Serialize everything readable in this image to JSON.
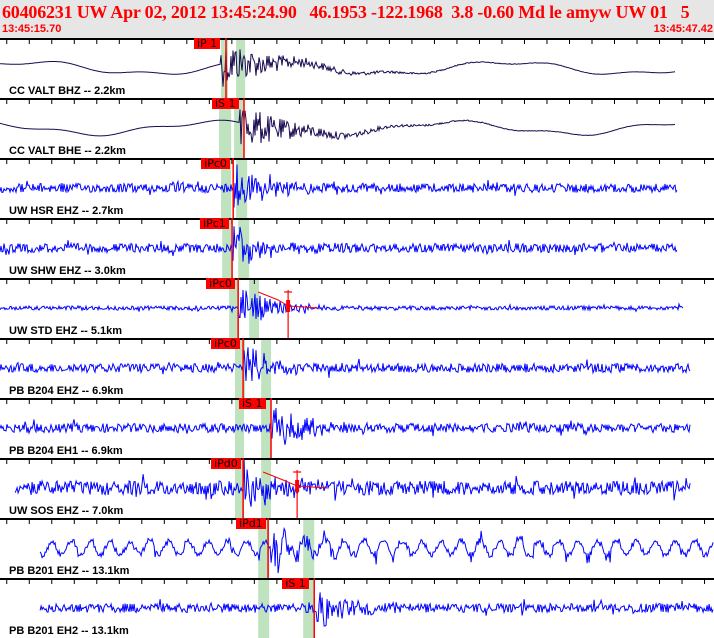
{
  "header": {
    "title": "60406231 UW Apr 02, 2012 13:45:24.90   46.1953 -122.1968  3.8 -0.60 Md le amyw UW 01   5",
    "start_time": "13:45:15.70",
    "end_time": "13:45:47.42"
  },
  "window_seconds": 31.72,
  "colors": {
    "pick": "#ff0000",
    "band": "#bfe3bf",
    "trace_bb": "#1a0a50",
    "trace_sp": "#0000ff",
    "header_text": "#ff0000"
  },
  "traces": [
    {
      "label": "CC VALT BHZ -- 2.2km",
      "pick": "iP 1",
      "pick_t": 10.04,
      "bands": [
        [
          9.82,
          10.13
        ],
        [
          10.49,
          10.89
        ]
      ],
      "t0": 0.0,
      "t1": 30.0,
      "kind": "bb",
      "coda": null
    },
    {
      "label": "CC VALT BHE -- 2.2km",
      "pick": "iS 1",
      "pick_t": 10.84,
      "bands": [
        [
          9.73,
          10.27
        ],
        [
          10.4,
          10.84
        ]
      ],
      "t0": 0.0,
      "t1": 30.0,
      "kind": "bb",
      "coda": null
    },
    {
      "label": "UW HSR EHZ -- 2.7km",
      "pick": "iPc0",
      "pick_t": 10.36,
      "bands": [
        [
          9.82,
          10.27
        ],
        [
          10.49,
          10.98
        ]
      ],
      "t0": 0.0,
      "t1": 30.1,
      "kind": "sp",
      "coda": null
    },
    {
      "label": "UW SHW EHZ -- 3.0km",
      "pick": "iPc1",
      "pick_t": 10.31,
      "bands": [
        [
          9.87,
          10.31
        ],
        [
          10.58,
          11.07
        ]
      ],
      "t0": 0.0,
      "t1": 30.1,
      "kind": "sp",
      "coda": null
    },
    {
      "label": "UW STD EHZ -- 5.1km",
      "pick": "iPc0",
      "pick_t": 10.58,
      "bands": [
        [
          10.18,
          10.58
        ],
        [
          11.07,
          11.51
        ]
      ],
      "t0": 0.0,
      "t1": 30.35,
      "kind": "sp_quiet",
      "coda": 12.8
    },
    {
      "label": "PB B204 EHZ -- 6.9km",
      "pick": "iPc0",
      "pick_t": 10.8,
      "bands": [
        [
          10.44,
          10.89
        ],
        [
          11.6,
          12.04
        ]
      ],
      "t0": 0.0,
      "t1": 30.66,
      "kind": "sp",
      "coda": null
    },
    {
      "label": "PB B204 EH1 -- 6.9km",
      "pick": "iS 1",
      "pick_t": 12.04,
      "bands": [
        [
          10.44,
          10.84
        ],
        [
          11.6,
          12.04
        ]
      ],
      "t0": 0.0,
      "t1": 30.66,
      "kind": "sp",
      "coda": null
    },
    {
      "label": "UW SOS EHZ -- 7.0km",
      "pick": "iPd0",
      "pick_t": 10.8,
      "bands": [
        [
          10.44,
          10.84
        ],
        [
          11.6,
          12.04
        ]
      ],
      "t0": 0.67,
      "t1": 30.66,
      "kind": "sp_noisy",
      "coda": 13.2
    },
    {
      "label": "PB B201 EHZ -- 13.1km",
      "pick": "iPd1",
      "pick_t": 11.91,
      "bands": [
        [
          11.47,
          11.96
        ],
        [
          13.47,
          13.96
        ]
      ],
      "t0": 1.78,
      "t1": 31.72,
      "kind": "sp_long",
      "coda": null
    },
    {
      "label": "PB B201 EH2 -- 13.1km",
      "pick": "iS 1",
      "pick_t": 13.96,
      "bands": [
        [
          11.47,
          11.96
        ],
        [
          13.47,
          13.96
        ]
      ],
      "t0": 1.78,
      "t1": 31.72,
      "kind": "sp",
      "coda": null
    }
  ]
}
